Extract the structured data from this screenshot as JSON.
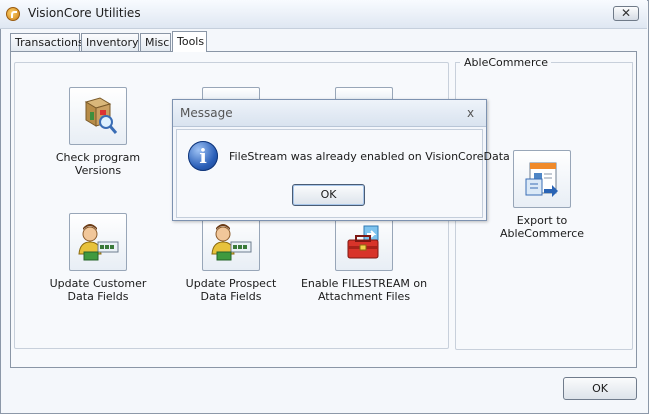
{
  "window": {
    "title": "VisionCore Utilities",
    "icon": "app-logo-icon",
    "close_label": "✕"
  },
  "tabs": [
    {
      "label": "Transactions",
      "active": false
    },
    {
      "label": "Inventory",
      "active": false
    },
    {
      "label": "Misc",
      "active": false
    },
    {
      "label": "Tools",
      "active": true
    }
  ],
  "tools": {
    "check_program_versions": {
      "label": "Check program\nVersions",
      "icon": "package-search-icon"
    },
    "update_customer_data_fields": {
      "label": "Update Customer\nData Fields",
      "icon": "user-data-icon"
    },
    "update_prospect_data_fields": {
      "label": "Update Prospect\nData Fields",
      "icon": "user-data-icon"
    },
    "enable_filestream": {
      "label": "Enable FILESTREAM on\nAttachment Files",
      "icon": "toolbox-icon"
    }
  },
  "ablecommerce": {
    "group_title": "AbleCommerce",
    "export": {
      "label": "Export to\nAbleCommerce",
      "icon": "export-document-icon"
    }
  },
  "footer": {
    "ok_label": "OK"
  },
  "dialog": {
    "title": "Message",
    "close_label": "x",
    "icon": "info-icon",
    "message": "FileStream was already enabled on VisionCoreData",
    "ok_label": "OK"
  }
}
